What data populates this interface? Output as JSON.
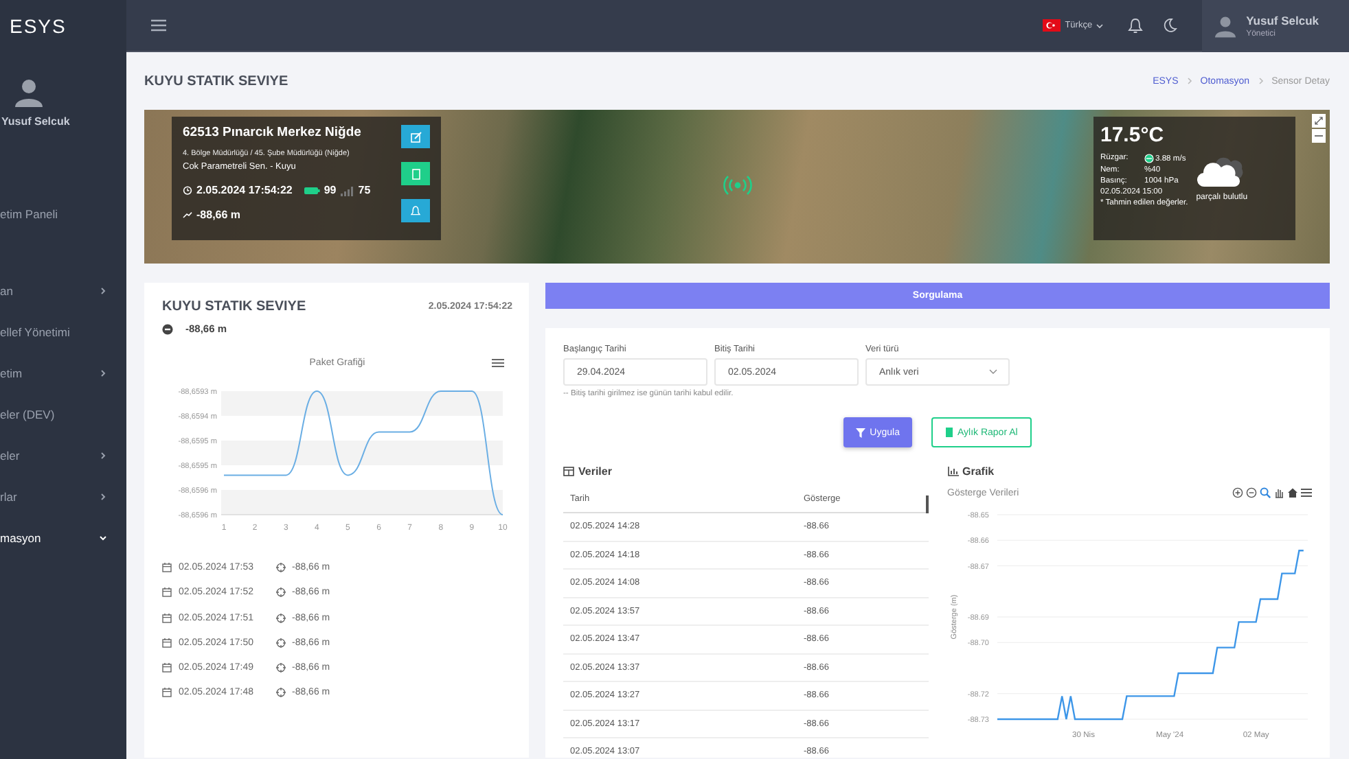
{
  "sidebar": {
    "brand": "ESYS",
    "user": "Yusuf Selcuk",
    "items": [
      {
        "label": "etim Paneli",
        "kind": "link",
        "selected": false
      },
      {
        "label": "an",
        "kind": "group",
        "expanded": false,
        "selected": false
      },
      {
        "label": "ellef Yönetimi",
        "kind": "link",
        "selected": false
      },
      {
        "label": "etim",
        "kind": "group",
        "expanded": false,
        "selected": false
      },
      {
        "label": "eler (DEV)",
        "kind": "link",
        "selected": false
      },
      {
        "label": "eler",
        "kind": "group",
        "expanded": false,
        "selected": false
      },
      {
        "label": "rlar",
        "kind": "group",
        "expanded": false,
        "selected": false
      },
      {
        "label": "masyon",
        "kind": "group",
        "expanded": true,
        "selected": true
      }
    ]
  },
  "topbar": {
    "language": "Türkçe",
    "user_name": "Yusuf Selcuk",
    "user_role": "Yönetici"
  },
  "page": {
    "title": "KUYU STATIK SEVIYE",
    "breadcrumb": [
      {
        "label": "ESYS",
        "kind": "link"
      },
      {
        "label": "Otomasyon",
        "kind": "link"
      },
      {
        "label": "Sensor Detay",
        "kind": "current"
      }
    ]
  },
  "station": {
    "name": "62513 Pınarcık Merkez Niğde",
    "region": "4. Bölge Müdürlüğü / 45. Şube Müdürlüğü (Niğde)",
    "type": "Cok Parametreli Sen. - Kuyu",
    "timestamp": "2.05.2024 17:54:22",
    "battery": "99",
    "signal": "75",
    "level_reading": "-88,66 m"
  },
  "weather": {
    "temperature": "17.5°C",
    "rows": [
      {
        "label": "Rüzgar:",
        "value": "3.88 m/s",
        "kind": "wind"
      },
      {
        "label": "Nem:",
        "value": "%40",
        "kind": "plain"
      },
      {
        "label": "Basınç:",
        "value": "1004 hPa",
        "kind": "plain"
      }
    ],
    "time": "02.05.2024 15:00",
    "note": "* Tahmin edilen değerler.",
    "description": "parçalı bulutlu"
  },
  "level_card": {
    "title": "KUYU STATIK SEVIYE",
    "timestamp": "2.05.2024 17:54:22",
    "value": "-88,66  m",
    "chart_title": "Paket Grafiği",
    "chart_y_labels": [
      "-88,6593 m",
      "-88,6594 m",
      "-88,6595 m",
      "-88,6595 m",
      "-88,6596 m",
      "-88,6596 m"
    ],
    "chart_x_labels": [
      "1",
      "2",
      "3",
      "4",
      "5",
      "6",
      "7",
      "8",
      "9",
      "10"
    ],
    "history": [
      {
        "time": "02.05.2024 17:53",
        "value": "-88,66 m"
      },
      {
        "time": "02.05.2024 17:52",
        "value": "-88,66 m"
      },
      {
        "time": "02.05.2024 17:51",
        "value": "-88,66 m"
      },
      {
        "time": "02.05.2024 17:50",
        "value": "-88,66 m"
      },
      {
        "time": "02.05.2024 17:49",
        "value": "-88,66 m"
      },
      {
        "time": "02.05.2024 17:48",
        "value": "-88,66 m"
      }
    ]
  },
  "query": {
    "button": "Sorgulama",
    "fields": [
      {
        "label": "Başlangıç Tarihi",
        "value": "29.04.2024",
        "kind": "input"
      },
      {
        "label": "Bitiş Tarihi",
        "value": "02.05.2024",
        "kind": "input"
      },
      {
        "label": "Veri türü",
        "value": "Anlık veri",
        "kind": "select"
      }
    ],
    "hint": "-- Bitiş tarihi girilmez ise günün tarihi kabul edilir.",
    "buttons": [
      {
        "label": "Uygula",
        "kind": "primary"
      },
      {
        "label": "Aylık Rapor Al",
        "kind": "report"
      }
    ],
    "table": {
      "title": "Veriler",
      "columns": [
        "Tarih",
        "Gösterge"
      ],
      "rows": [
        [
          "02.05.2024 14:28",
          "-88.66"
        ],
        [
          "02.05.2024 14:18",
          "-88.66"
        ],
        [
          "02.05.2024 14:08",
          "-88.66"
        ],
        [
          "02.05.2024 13:57",
          "-88.66"
        ],
        [
          "02.05.2024 13:47",
          "-88.66"
        ],
        [
          "02.05.2024 13:37",
          "-88.66"
        ],
        [
          "02.05.2024 13:27",
          "-88.66"
        ],
        [
          "02.05.2024 13:17",
          "-88.66"
        ],
        [
          "02.05.2024 13:07",
          "-88.66"
        ]
      ]
    },
    "graph": {
      "title": "Grafik",
      "chart_data": {
        "type": "line",
        "title": "Gösterge Verileri",
        "ylabel": "Gösterge (m)",
        "categories": [
          null,
          null,
          null,
          null,
          null,
          null,
          null,
          null,
          null,
          null,
          null,
          null,
          null,
          null,
          null,
          null,
          null,
          null,
          null,
          null,
          "30 Nis",
          null,
          null,
          null,
          null,
          null,
          null,
          null,
          null,
          null,
          null,
          null,
          null,
          null,
          null,
          null,
          null,
          null,
          null,
          null,
          "May '24",
          null,
          null,
          null,
          null,
          null,
          null,
          null,
          null,
          null,
          null,
          null,
          null,
          null,
          null,
          null,
          null,
          null,
          null,
          null,
          "02 May",
          null,
          null,
          null,
          null,
          null,
          null,
          null,
          null,
          null,
          null,
          null
        ],
        "values": [
          -88.73,
          -88.73,
          -88.73,
          -88.73,
          -88.73,
          -88.73,
          -88.73,
          -88.73,
          -88.73,
          -88.73,
          -88.73,
          -88.73,
          -88.73,
          -88.73,
          -88.73,
          -88.721,
          -88.73,
          -88.721,
          -88.73,
          -88.73,
          -88.73,
          -88.73,
          -88.73,
          -88.73,
          -88.73,
          -88.73,
          -88.73,
          -88.73,
          -88.73,
          -88.73,
          -88.721,
          -88.721,
          -88.721,
          -88.721,
          -88.721,
          -88.721,
          -88.721,
          -88.721,
          -88.721,
          -88.721,
          -88.721,
          -88.721,
          -88.712,
          -88.712,
          -88.712,
          -88.712,
          -88.712,
          -88.712,
          -88.712,
          -88.712,
          -88.712,
          -88.702,
          -88.702,
          -88.702,
          -88.702,
          -88.702,
          -88.692,
          -88.692,
          -88.692,
          -88.692,
          -88.692,
          -88.683,
          -88.683,
          -88.683,
          -88.683,
          -88.683,
          -88.673,
          -88.673,
          -88.673,
          -88.673,
          -88.664,
          -88.664
        ],
        "ylim": [
          -88.73,
          -88.65
        ],
        "grid": true,
        "yticks": [
          {
            "value": -88.65,
            "label": "-88.65"
          },
          {
            "value": -88.66,
            "label": "-88.66"
          },
          {
            "value": -88.67,
            "label": "-88.67"
          },
          {
            "value": -88.69,
            "label": "-88.69"
          },
          {
            "value": -88.7,
            "label": "-88.70"
          },
          {
            "value": -88.72,
            "label": "-88.72"
          },
          {
            "value": -88.73,
            "label": "-88.73"
          }
        ]
      }
    }
  }
}
